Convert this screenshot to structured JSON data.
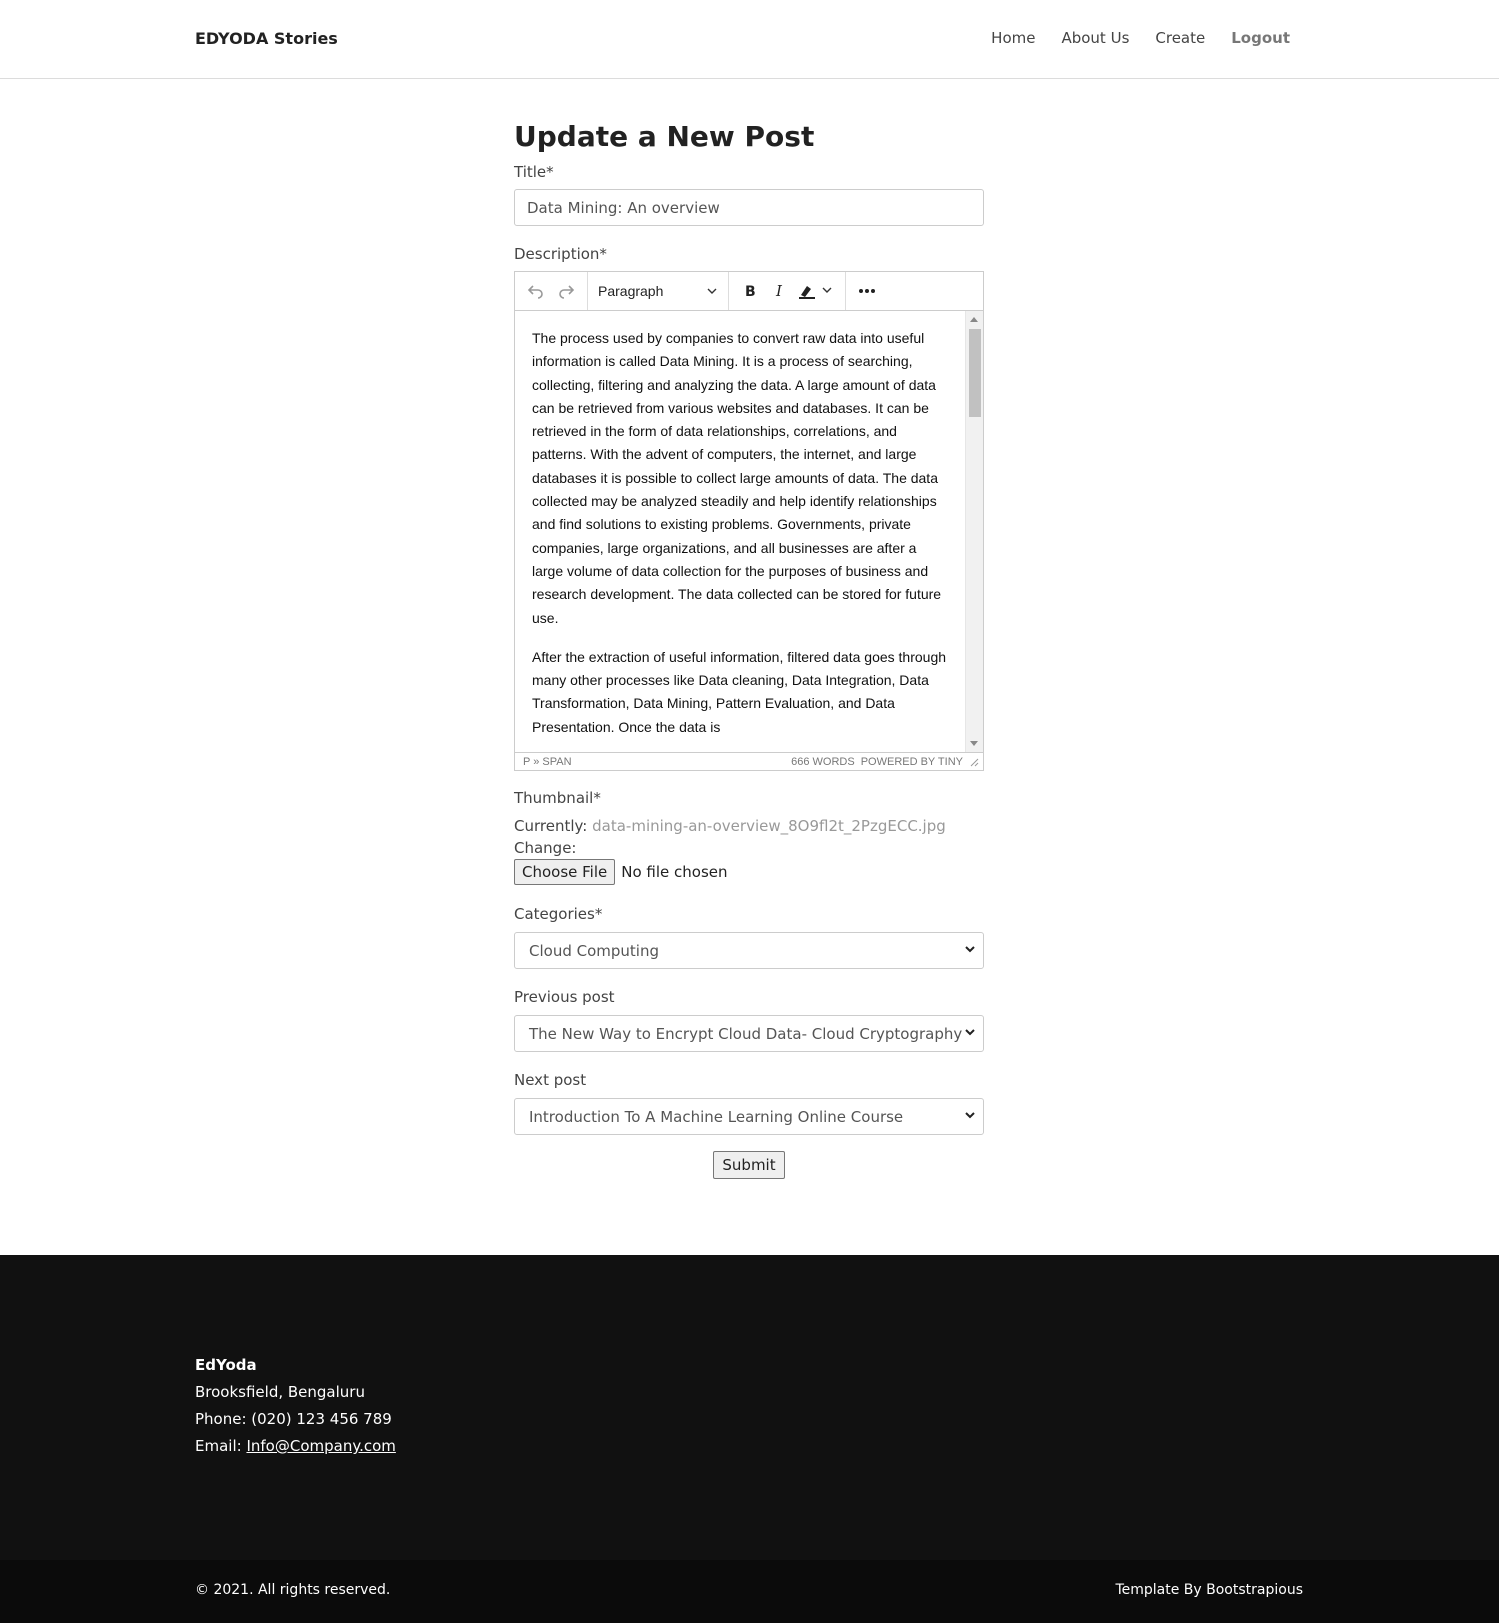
{
  "nav": {
    "brand": "EDYODA Stories",
    "links": [
      "Home",
      "About Us",
      "Create",
      "Logout"
    ]
  },
  "form": {
    "heading": "Update a New Post",
    "title_label": "Title*",
    "title_value": "Data Mining: An overview",
    "description_label": "Description*",
    "editor": {
      "format": "Paragraph",
      "paragraphs": [
        "The process used by companies to convert raw data into useful information is called Data Mining. It is a process of searching, collecting, filtering and analyzing the data. A large amount of data can be retrieved from various websites and databases. It can be retrieved in the form of data relationships, correlations, and patterns. With the advent of computers, the internet, and large databases it is possible to collect large amounts of data. The data collected may be analyzed steadily and help identify relationships and find solutions to existing problems. Governments, private companies, large organizations, and all businesses are after a large volume of data collection for the purposes of business and research development. The data collected can be stored for future use.",
        "After the extraction of useful information, filtered data goes through many other processes like Data cleaning, Data Integration, Data Transformation, Data Mining, Pattern Evaluation, and Data Presentation. Once the data is"
      ],
      "path": "P » SPAN",
      "word_count": "666 WORDS",
      "powered_by": "POWERED BY TINY"
    },
    "thumbnail_label": "Thumbnail*",
    "currently_label": "Currently:",
    "current_file": "data-mining-an-overview_8O9fl2t_2PzgECC.jpg",
    "change_label": "Change:",
    "choose_file": "Choose File",
    "no_file": "No file chosen",
    "categories_label": "Categories*",
    "category_value": "Cloud Computing",
    "previous_label": "Previous post",
    "previous_value": "The New Way to Encrypt Cloud Data- Cloud Cryptography",
    "next_label": "Next post",
    "next_value": "Introduction To A Machine Learning Online Course",
    "submit": "Submit"
  },
  "footer": {
    "company": "EdYoda",
    "address": "Brooksfield, Bengaluru",
    "phone": "Phone: (020) 123 456 789",
    "email_label": "Email:",
    "email": "Info@Company.com",
    "copyright": "© 2021. All rights reserved.",
    "template_label": "Template By",
    "template_author": "Bootstrapious"
  }
}
